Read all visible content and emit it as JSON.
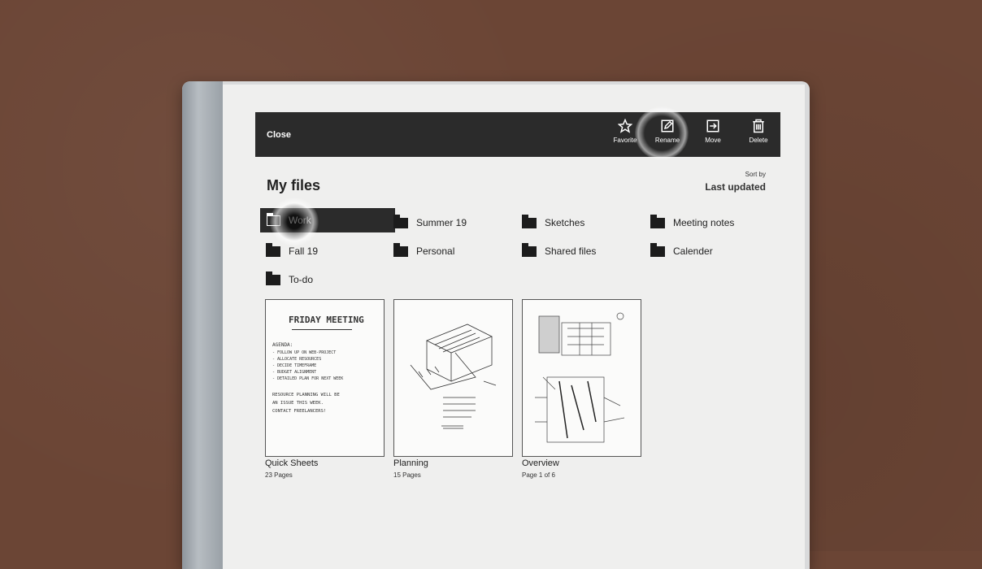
{
  "topbar": {
    "close": "Close",
    "favorite": "Favorite",
    "rename": "Rename",
    "move": "Move",
    "delete": "Delete"
  },
  "page_title": "My files",
  "sort": {
    "label": "Sort by",
    "value": "Last updated"
  },
  "folders": [
    {
      "name": "Work",
      "selected": true
    },
    {
      "name": "Summer 19"
    },
    {
      "name": "Sketches"
    },
    {
      "name": "Meeting notes"
    },
    {
      "name": "Fall 19"
    },
    {
      "name": "Personal"
    },
    {
      "name": "Shared files"
    },
    {
      "name": "Calender"
    },
    {
      "name": "To-do"
    }
  ],
  "notebooks": [
    {
      "title": "Quick Sheets",
      "sub": "23 Pages",
      "sketch": {
        "heading": "FRIDAY MEETING",
        "lines": [
          "AGENDA:",
          "- FOLLOW UP ON WEB-PROJECT",
          "- ALLOCATE RESOURCES",
          "- DECIDE TIMEFRAME",
          "- BUDGET ALIGNMENT",
          "- DETAILED PLAN FOR NEXT WEEK",
          "RESOURCE PLANNING WILL BE",
          "AN ISSUE THIS WEEK.",
          "CONTACT FREELANCERS!"
        ]
      }
    },
    {
      "title": "Planning",
      "sub": "15 Pages"
    },
    {
      "title": "Overview",
      "sub": "Page 1 of 6"
    }
  ],
  "icons": [
    "star-icon",
    "pencil-icon",
    "move-icon",
    "trash-icon",
    "folder-icon"
  ]
}
